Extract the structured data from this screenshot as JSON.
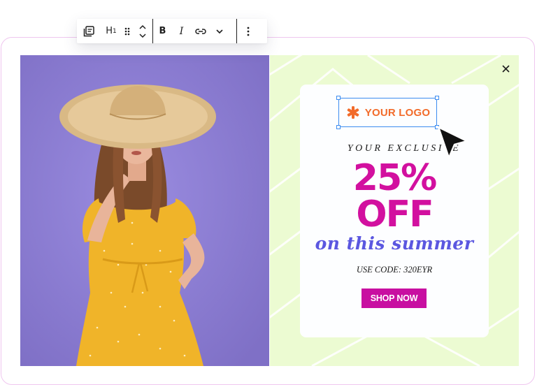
{
  "toolbar": {
    "heading_label": "H",
    "heading_level": "1",
    "bold_label": "B",
    "italic_label": "I"
  },
  "popup": {
    "logo_text": "YOUR LOGO",
    "kicker": "YOUR EXCLUSIVE",
    "discount": "25%",
    "off": "OFF",
    "tagline": "on this summer",
    "code_text": "USE CODE: 320EYR",
    "cta": "SHOP NOW"
  },
  "colors": {
    "photo_bg": "#8f7fd4",
    "promo_bg": "#ecfbd2",
    "accent_magenta": "#d2109f",
    "cta_bg": "#c80fa1",
    "logo_orange": "#f26b2a",
    "tagline_blue": "#5b57e0",
    "selection_blue": "#3c8cf0",
    "frame_border": "#efc6ef"
  },
  "icons": {
    "block_type": "block-type-icon",
    "drag": "drag-handle-icon",
    "move": "move-up-down-icon",
    "link": "link-icon",
    "more_rich_text": "chevron-down-icon",
    "options": "more-vertical-icon",
    "close": "close-icon",
    "logo_mark": "asterisk-logo-icon",
    "pointer": "cursor-arrow-icon"
  }
}
